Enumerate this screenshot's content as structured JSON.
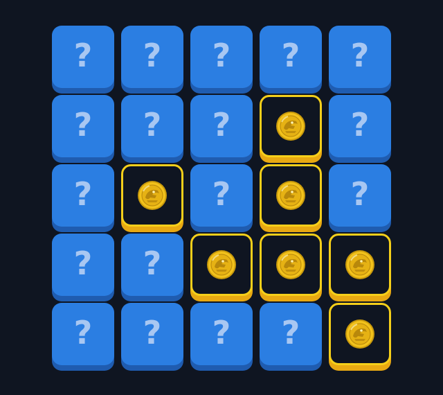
{
  "board": {
    "question_glyph": "?",
    "colors": {
      "background": "#0f1521",
      "tile_face": "#2b7ee2",
      "tile_edge": "#1f5cb0",
      "question_mark": "#a8c7f2",
      "revealed_border": "#f5cf1a",
      "revealed_edge": "#e8a912",
      "coin_gold": "#f2c21c",
      "coin_dark": "#c99a0c"
    },
    "rows": [
      [
        "hidden",
        "hidden",
        "hidden",
        "hidden",
        "hidden"
      ],
      [
        "hidden",
        "hidden",
        "hidden",
        "coin",
        "hidden"
      ],
      [
        "hidden",
        "coin",
        "hidden",
        "coin",
        "hidden"
      ],
      [
        "hidden",
        "hidden",
        "coin",
        "coin",
        "coin"
      ],
      [
        "hidden",
        "hidden",
        "hidden",
        "hidden",
        "coin"
      ]
    ]
  }
}
